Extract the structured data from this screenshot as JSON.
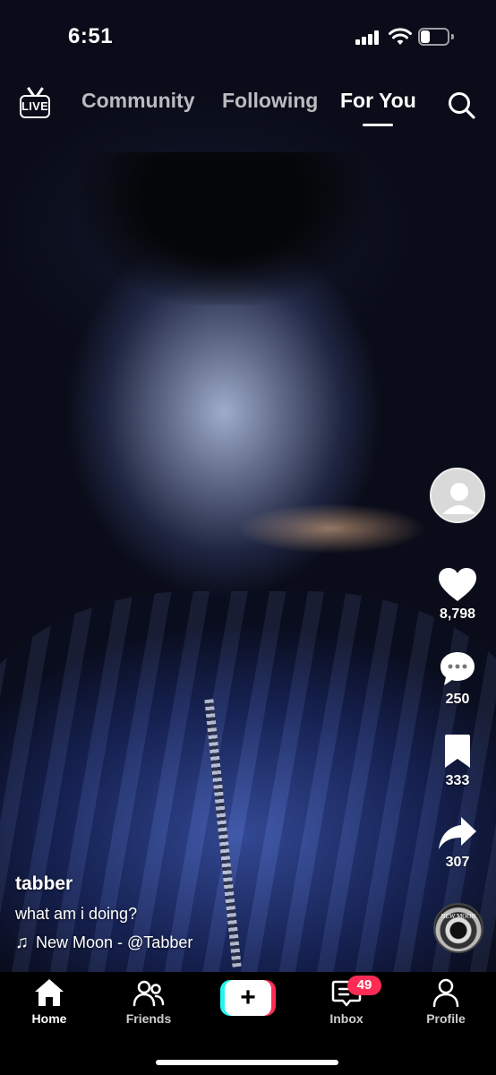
{
  "status_bar": {
    "time": "6:51"
  },
  "top_nav": {
    "live_label": "LIVE",
    "tabs": [
      {
        "label": "Community",
        "active": false
      },
      {
        "label": "Following",
        "active": false
      },
      {
        "label": "For You",
        "active": true
      }
    ]
  },
  "actions": {
    "likes": "8,798",
    "comments": "250",
    "bookmarks": "333",
    "shares": "307"
  },
  "post": {
    "username": "tabber",
    "description": "what am i doing?",
    "music_icon": "♫",
    "sound": "New Moon - @Tabber",
    "disc_text": "NEW MOON"
  },
  "bottom_nav": {
    "home": "Home",
    "friends": "Friends",
    "create": "+",
    "inbox": "Inbox",
    "inbox_badge": "49",
    "profile": "Profile"
  },
  "colors": {
    "accent_pink": "#fe2c55",
    "accent_cyan": "#25f4ee"
  },
  "icons": [
    "live-icon",
    "search-icon",
    "heart-icon",
    "comment-icon",
    "bookmark-icon",
    "share-icon",
    "home-icon",
    "friends-icon",
    "inbox-icon",
    "profile-icon"
  ]
}
